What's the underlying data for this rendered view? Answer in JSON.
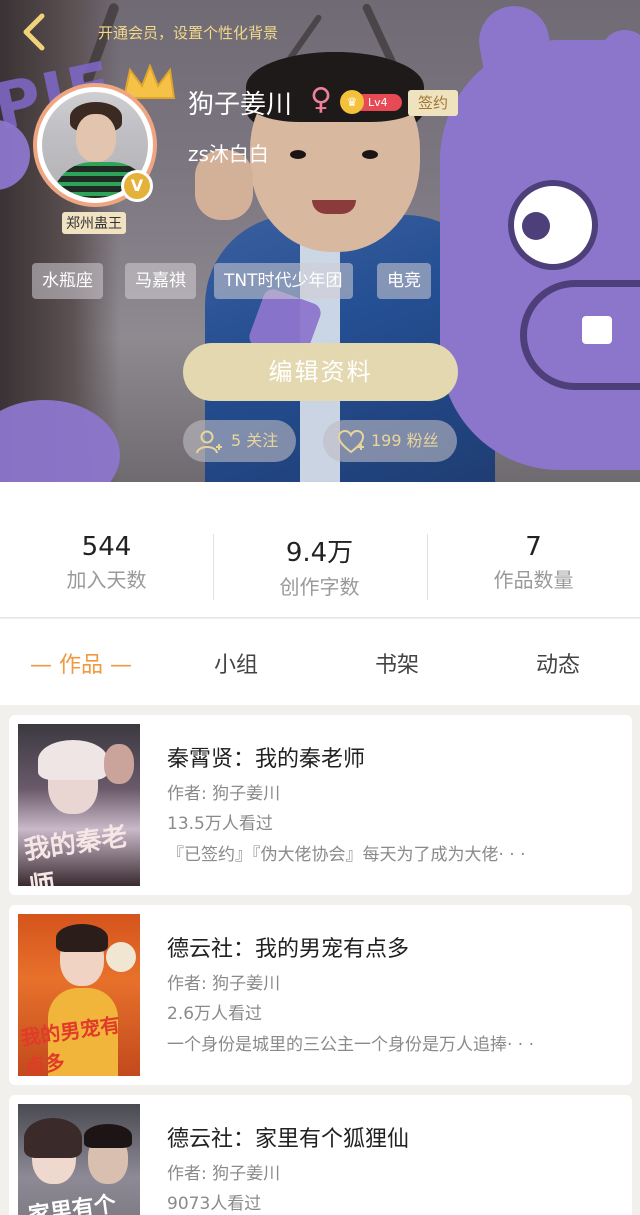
{
  "header": {
    "vip_tip": "开通会员，设置个性化背景",
    "background_word": "PIE"
  },
  "profile": {
    "username": "狗子姜川",
    "gender_symbol": "♀",
    "level": "Lv4",
    "signed_label": "签约",
    "bio": "zs沐白白",
    "location_tag": "郑州蛊王",
    "verified_mark": "V"
  },
  "tags": [
    "水瓶座",
    "马嘉祺",
    "TNT时代少年团",
    "电竞"
  ],
  "actions": {
    "edit_label": "编辑资料",
    "follow_label": "5 关注",
    "fans_label": "199 粉丝"
  },
  "stats": [
    {
      "value": "544",
      "label": "加入天数"
    },
    {
      "value": "9.4万",
      "label": "创作字数"
    },
    {
      "value": "7",
      "label": "作品数量"
    }
  ],
  "tabs": [
    {
      "label": "— 作品 —",
      "active": true
    },
    {
      "label": "小组",
      "active": false
    },
    {
      "label": "书架",
      "active": false
    },
    {
      "label": "动态",
      "active": false
    }
  ],
  "works": [
    {
      "title": "秦霄贤：我的秦老师",
      "author": "作者: 狗子姜川",
      "views": "13.5万人看过",
      "desc": "『已签约』『伪大佬协会』每天为了成为大佬· · ·",
      "cover_text": "我的秦老师"
    },
    {
      "title": "德云社：我的男宠有点多",
      "author": "作者: 狗子姜川",
      "views": "2.6万人看过",
      "desc": "一个身份是城里的三公主一个身份是万人追捧· · ·",
      "cover_text": "我的男宠有点多"
    },
    {
      "title": "德云社：家里有个狐狸仙",
      "author": "作者: 狗子姜川",
      "views": "9073人看过",
      "desc": "",
      "cover_text": "家里有个"
    }
  ],
  "colors": {
    "accent": "#f0993f",
    "edit_button": "#e4d8b0",
    "pill_text": "#e9d59c",
    "signed_bg": "#efe2bf",
    "level_bg": "#e84a55",
    "gender": "#f07f9a",
    "monster": "#8c76cc"
  },
  "icons": {
    "back": "chevron-left-icon",
    "follow": "add-user-icon",
    "fans": "heart-icon",
    "crown": "crown-icon"
  }
}
